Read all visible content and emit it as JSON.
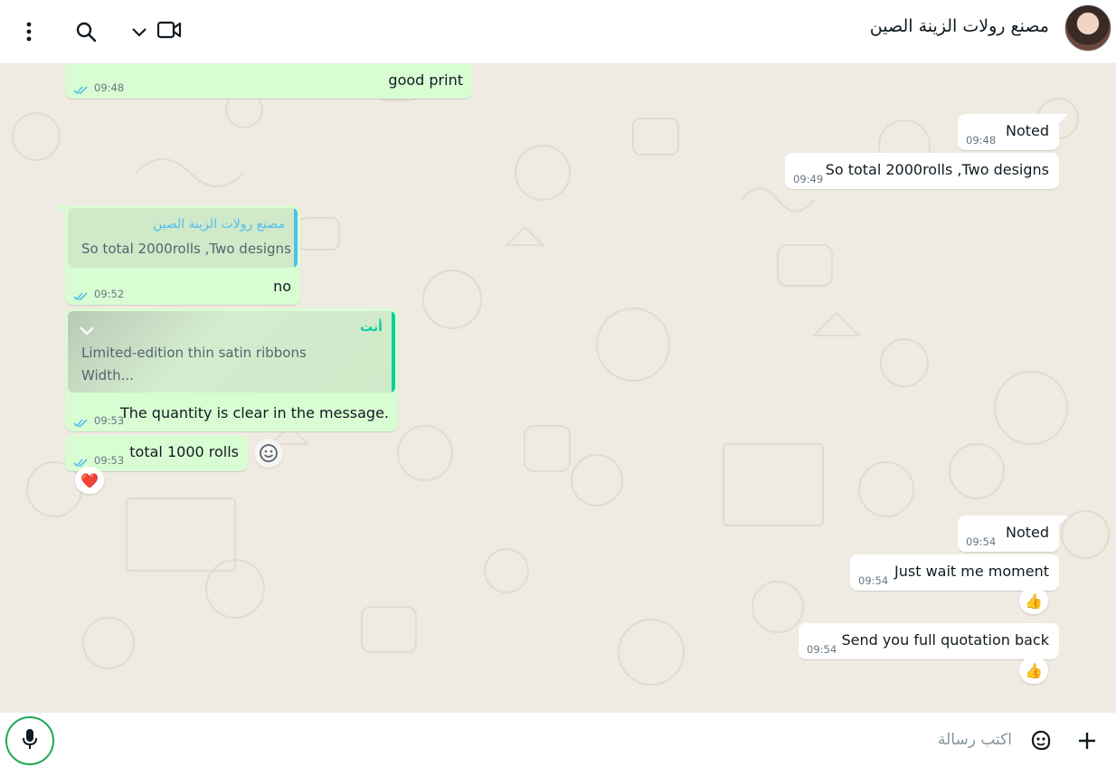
{
  "header": {
    "chat_title": "مصنع رولات الزينة الصين"
  },
  "messages": [
    {
      "id": "m1",
      "direction": "outgoing",
      "text": "good print",
      "time": "09:48",
      "ticks": "read"
    },
    {
      "id": "m2",
      "direction": "incoming",
      "text": "Noted",
      "time": "09:48"
    },
    {
      "id": "m3",
      "direction": "incoming",
      "text": "So total 2000rolls ,Two designs",
      "time": "09:49"
    },
    {
      "id": "m4",
      "direction": "outgoing",
      "quote_author": "مصنع رولات الزينة الصين",
      "quote_text": "So total 2000rolls ,Two designs",
      "text": "no",
      "time": "09:52",
      "ticks": "read"
    },
    {
      "id": "m5",
      "direction": "outgoing",
      "quote_author": "أنت",
      "quote_text_line1": "Limited-edition thin satin ribbons",
      "quote_text_line2": "Width...",
      "text": "The quantity is clear in the message.",
      "time": "09:53",
      "ticks": "read"
    },
    {
      "id": "m6",
      "direction": "outgoing",
      "text": "total 1000 rolls",
      "time": "09:53",
      "ticks": "read",
      "reaction": "❤️"
    },
    {
      "id": "m7",
      "direction": "incoming",
      "text": "Noted",
      "time": "09:54"
    },
    {
      "id": "m8",
      "direction": "incoming",
      "text": "Just wait me moment",
      "time": "09:54",
      "reaction": "👍"
    },
    {
      "id": "m9",
      "direction": "incoming",
      "text": "Send you full quotation back",
      "time": "09:54",
      "reaction": "👍"
    }
  ],
  "composer": {
    "placeholder": "اكتب رسالة"
  },
  "colors": {
    "outgoing_bubble": "#d9fdd3",
    "incoming_bubble": "#ffffff",
    "chat_background": "#efeae2",
    "read_ticks": "#53bdeb",
    "accent_green": "#1fa855",
    "quote_author_blue": "#53bdeb",
    "quote_author_green": "#06cf9c"
  },
  "icons": [
    "menu-icon",
    "search-icon",
    "chevron-down-icon",
    "video-call-icon",
    "avatar",
    "mic-icon",
    "sticker-icon",
    "plus-icon",
    "emoji-react-icon",
    "double-check-icon"
  ]
}
